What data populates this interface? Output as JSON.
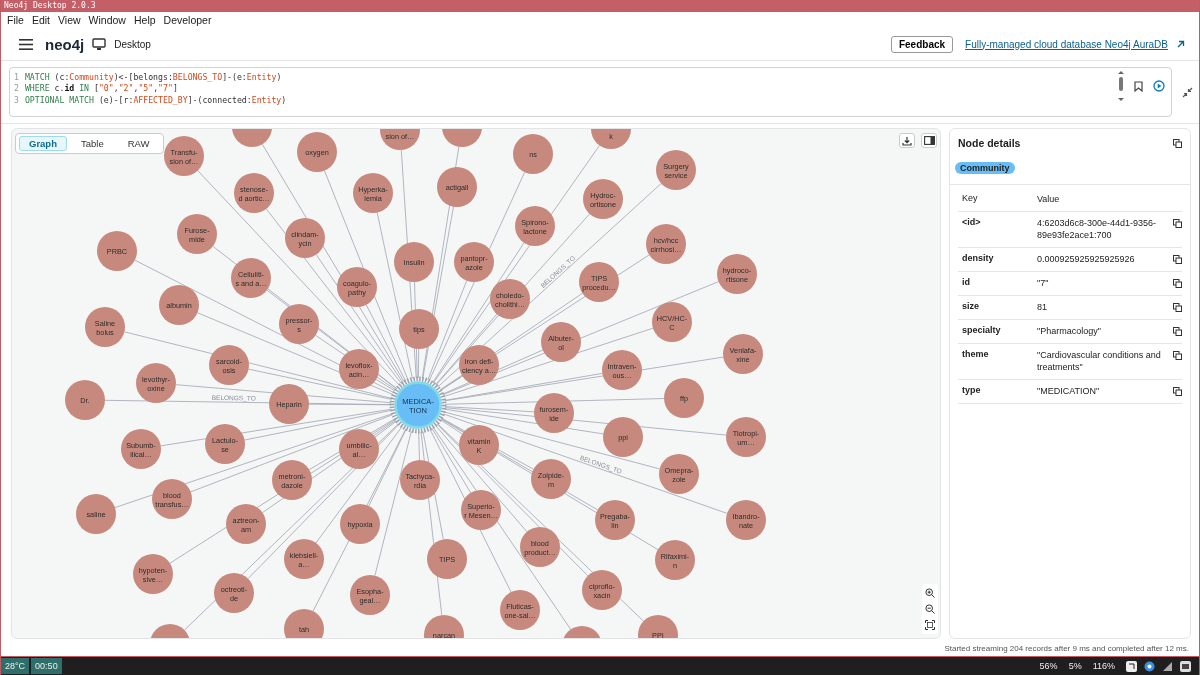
{
  "window": {
    "title": "Neo4j Desktop 2.0.3"
  },
  "menu": [
    "File",
    "Edit",
    "View",
    "Window",
    "Help",
    "Developer"
  ],
  "header": {
    "logo": "neo4j",
    "section": "Desktop",
    "feedback": "Feedback",
    "link": "Fully-managed cloud database Neo4j AuraDB"
  },
  "editor": {
    "lines": [
      {
        "number": "1",
        "tokens": [
          {
            "text": "MATCH",
            "kind": "keyword"
          },
          {
            "text": " (c:",
            "kind": "plain"
          },
          {
            "text": "Community",
            "kind": "label"
          },
          {
            "text": ")<-[belongs:",
            "kind": "plain"
          },
          {
            "text": "BELONGS_TO",
            "kind": "label"
          },
          {
            "text": "]-(e:",
            "kind": "plain"
          },
          {
            "text": "Entity",
            "kind": "label"
          },
          {
            "text": ")",
            "kind": "plain"
          }
        ]
      },
      {
        "number": "2",
        "tokens": [
          {
            "text": "WHERE",
            "kind": "keyword"
          },
          {
            "text": " c.",
            "kind": "plain"
          },
          {
            "text": "id",
            "kind": "property"
          },
          {
            "text": " IN",
            "kind": "keyword"
          },
          {
            "text": " [",
            "kind": "plain"
          },
          {
            "text": "\"0\"",
            "kind": "string"
          },
          {
            "text": ",",
            "kind": "plain"
          },
          {
            "text": "\"2\"",
            "kind": "string"
          },
          {
            "text": ",",
            "kind": "plain"
          },
          {
            "text": "\"5\"",
            "kind": "string"
          },
          {
            "text": ",",
            "kind": "plain"
          },
          {
            "text": "\"7\"",
            "kind": "string"
          },
          {
            "text": "]",
            "kind": "plain"
          }
        ]
      },
      {
        "number": "3",
        "tokens": [
          {
            "text": "OPTIONAL MATCH",
            "kind": "keyword"
          },
          {
            "text": " (e)-[r:",
            "kind": "plain"
          },
          {
            "text": "AFFECTED_BY",
            "kind": "label"
          },
          {
            "text": "]-(connected:",
            "kind": "plain"
          },
          {
            "text": "Entity",
            "kind": "label"
          },
          {
            "text": ")",
            "kind": "plain"
          }
        ]
      }
    ]
  },
  "view_tabs": [
    {
      "label": "Graph",
      "selected": true
    },
    {
      "label": "Table",
      "selected": false
    },
    {
      "label": "RAW",
      "selected": false
    }
  ],
  "graph": {
    "center": {
      "lines": [
        "MEDICA-",
        "TION"
      ]
    },
    "nodes": [
      {
        "kind": "node",
        "lines": [
          "PRBC"
        ]
      },
      {
        "kind": "node",
        "lines": [
          "Saline",
          "bolus"
        ]
      },
      {
        "kind": "node",
        "lines": [
          "Dr."
        ],
        "edge_label": "BELONGS_TO"
      },
      {
        "kind": "node",
        "lines": [
          "saline"
        ]
      },
      {
        "kind": "node",
        "lines": [
          "Transfu-",
          "sion of…"
        ]
      },
      {
        "kind": "node",
        "lines": [
          "Furose-",
          "mide"
        ]
      },
      {
        "kind": "node",
        "lines": [
          "albumin"
        ]
      },
      {
        "kind": "node",
        "lines": [
          "levothyr-",
          "oxine"
        ]
      },
      {
        "kind": "node",
        "lines": [
          "Subumb-",
          "ilical…"
        ]
      },
      {
        "kind": "node",
        "lines": [
          "blood",
          "transfus…"
        ]
      },
      {
        "kind": "node",
        "lines": [
          "hypoten-",
          "sive…"
        ]
      },
      {
        "kind": "cut"
      },
      {
        "kind": "cut"
      },
      {
        "kind": "node",
        "lines": [
          "stenose-",
          "d aortic…"
        ]
      },
      {
        "kind": "node",
        "lines": [
          "Celluliti-",
          "s and a…"
        ]
      },
      {
        "kind": "node",
        "lines": [
          "sarcoid-",
          "osis"
        ]
      },
      {
        "kind": "node",
        "lines": [
          "Lactulo-",
          "se"
        ]
      },
      {
        "kind": "node",
        "lines": [
          "aztreon-",
          "am"
        ]
      },
      {
        "kind": "node",
        "lines": [
          "octreoti-",
          "de"
        ]
      },
      {
        "kind": "node",
        "lines": [
          "oxygen"
        ]
      },
      {
        "kind": "node",
        "lines": [
          "clindam-",
          "ycin"
        ]
      },
      {
        "kind": "node",
        "lines": [
          "pressor-",
          "s"
        ]
      },
      {
        "kind": "node",
        "lines": [
          "Heparin"
        ]
      },
      {
        "kind": "node",
        "lines": [
          "metroni-",
          "dazole"
        ]
      },
      {
        "kind": "node",
        "lines": [
          "klebsiell-",
          "a…"
        ]
      },
      {
        "kind": "node",
        "lines": [
          "tah"
        ]
      },
      {
        "kind": "node",
        "lines": [
          "sion of…"
        ]
      },
      {
        "kind": "node",
        "lines": [
          "Hyperka-",
          "lemia"
        ]
      },
      {
        "kind": "node",
        "lines": [
          "coagulo-",
          "pathy"
        ]
      },
      {
        "kind": "node",
        "lines": [
          "levoflox-",
          "acin…"
        ]
      },
      {
        "kind": "node",
        "lines": [
          "umbilic-",
          "al…"
        ]
      },
      {
        "kind": "node",
        "lines": [
          "hypoxia"
        ]
      },
      {
        "kind": "node",
        "lines": [
          "Esopha-",
          "geal…"
        ]
      },
      {
        "kind": "node",
        "lines": [
          "Insulin"
        ]
      },
      {
        "kind": "node",
        "lines": [
          "tips"
        ]
      },
      {
        "kind": "node",
        "lines": [
          "Tachyca-",
          "rdia"
        ]
      },
      {
        "kind": "cut"
      },
      {
        "kind": "node",
        "lines": [
          "actigall"
        ]
      },
      {
        "kind": "node",
        "lines": [
          "pantopr-",
          "azole"
        ]
      },
      {
        "kind": "node",
        "lines": [
          "ns"
        ]
      },
      {
        "kind": "node",
        "lines": [
          "Spirono-",
          "lactone"
        ]
      },
      {
        "kind": "node",
        "lines": [
          "choledo-",
          "cholithi…"
        ]
      },
      {
        "kind": "node",
        "lines": [
          "Iron defi-",
          "ciency a…"
        ]
      },
      {
        "kind": "node",
        "lines": [
          "vitamin",
          "K"
        ]
      },
      {
        "kind": "node",
        "lines": [
          "Superio-",
          "r Mesen…"
        ]
      },
      {
        "kind": "node",
        "lines": [
          "TIPS"
        ]
      },
      {
        "kind": "node",
        "lines": [
          "narcan"
        ]
      },
      {
        "kind": "node",
        "lines": [
          "k"
        ]
      },
      {
        "kind": "node",
        "lines": [
          "Hydroc-",
          "ortisone"
        ]
      },
      {
        "kind": "node",
        "lines": [
          "Surgery",
          "service"
        ],
        "edge_label": "BELONGS_TO"
      },
      {
        "kind": "node",
        "lines": [
          "TIPS",
          "procedu…"
        ]
      },
      {
        "kind": "node",
        "lines": [
          "Albuter-",
          "ol"
        ]
      },
      {
        "kind": "node",
        "lines": [
          "furosem-",
          "ide"
        ]
      },
      {
        "kind": "node",
        "lines": [
          "Zolpide-",
          "m"
        ]
      },
      {
        "kind": "node",
        "lines": [
          "blood",
          "product…"
        ]
      },
      {
        "kind": "node",
        "lines": [
          "Fluticas-",
          "one-sal…"
        ]
      },
      {
        "kind": "node",
        "lines": [
          "Intraven-",
          "ous…"
        ]
      },
      {
        "kind": "node",
        "lines": [
          "ppi"
        ]
      },
      {
        "kind": "node",
        "lines": [
          "Pregaba-",
          "lin"
        ]
      },
      {
        "kind": "node",
        "lines": [
          "ciproflo-",
          "xacin"
        ]
      },
      {
        "kind": "cut"
      },
      {
        "kind": "node",
        "lines": [
          "hcv/hcc",
          "cirrhosi…"
        ]
      },
      {
        "kind": "node",
        "lines": [
          "HCV/HC-",
          "C"
        ]
      },
      {
        "kind": "node",
        "lines": [
          "hydroco-",
          "rtisone"
        ]
      },
      {
        "kind": "node",
        "lines": [
          "Venlafa-",
          "xine"
        ]
      },
      {
        "kind": "node",
        "lines": [
          "ffp"
        ]
      },
      {
        "kind": "node",
        "lines": [
          "Omepra-",
          "zole"
        ]
      },
      {
        "kind": "node",
        "lines": [
          "Rifaximi-",
          "n"
        ]
      },
      {
        "kind": "node",
        "lines": [
          "PPI"
        ]
      },
      {
        "kind": "node",
        "lines": [
          "Tiotropi-",
          "um…"
        ]
      },
      {
        "kind": "node",
        "lines": [
          "Ibandro-",
          "nate"
        ],
        "edge_label": "BELONGS_TO"
      }
    ]
  },
  "details": {
    "title": "Node details",
    "badge": "Community",
    "columns": [
      "Key",
      "Value"
    ],
    "rows": [
      {
        "key": "<id>",
        "value": "4:6203d6c8-300e-44d1-9356-89e93fe2ace1:700"
      },
      {
        "key": "density",
        "value": "0.000925925925925926"
      },
      {
        "key": "id",
        "value": "\"7\""
      },
      {
        "key": "size",
        "value": "81"
      },
      {
        "key": "specialty",
        "value": "\"Pharmacology\""
      },
      {
        "key": "theme",
        "value": "\"Cardiovascular conditions and treatments\""
      },
      {
        "key": "type",
        "value": "\"MEDICATION\""
      }
    ]
  },
  "status": "Started streaming 204 records after 9 ms and completed after 12 ms.",
  "taskbar": {
    "weather": "28°C",
    "time": "00:50",
    "stats": [
      "56%",
      "5%",
      "116%"
    ]
  }
}
